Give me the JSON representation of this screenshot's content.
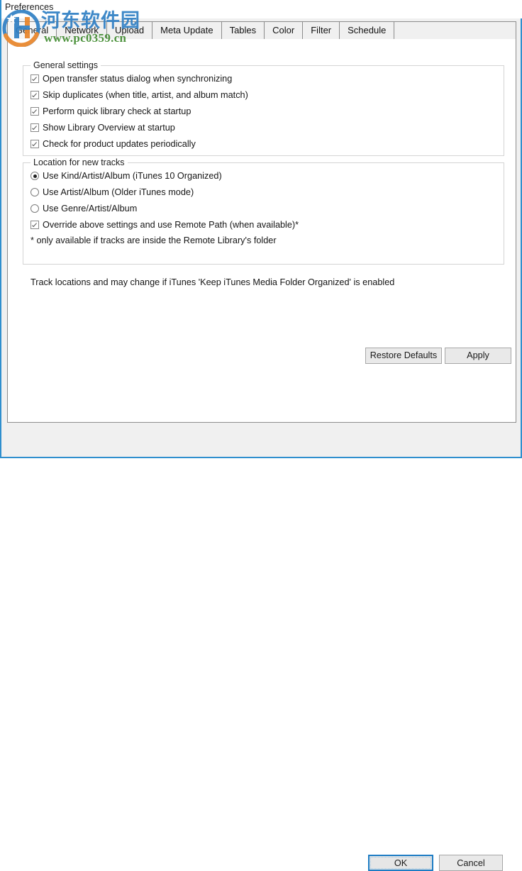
{
  "window": {
    "title": "Preferences",
    "accent_border_color": "#2f8fce",
    "dialog_bg": "#f0f0f0",
    "panel_bg": "#ffffff"
  },
  "tabs": [
    {
      "label": "General",
      "active": true
    },
    {
      "label": "Network",
      "active": false
    },
    {
      "label": "Upload",
      "active": false
    },
    {
      "label": "Meta Update",
      "active": false
    },
    {
      "label": "Tables",
      "active": false
    },
    {
      "label": "Color",
      "active": false
    },
    {
      "label": "Filter",
      "active": false
    },
    {
      "label": "Schedule",
      "active": false
    }
  ],
  "general_settings": {
    "legend": "General settings",
    "checkboxes": [
      {
        "label": "Open transfer status dialog when synchronizing",
        "checked": true
      },
      {
        "label": "Skip duplicates (when title, artist, and album match)",
        "checked": true
      },
      {
        "label": "Perform quick library check at startup",
        "checked": true
      },
      {
        "label": "Show Library Overview at startup",
        "checked": true
      },
      {
        "label": "Check for product updates periodically",
        "checked": true
      }
    ]
  },
  "location_for_new_tracks": {
    "legend": "Location for new tracks",
    "radios": [
      {
        "label": "Use Kind/Artist/Album (iTunes 10 Organized)",
        "selected": true
      },
      {
        "label": "Use Artist/Album (Older iTunes mode)",
        "selected": false
      },
      {
        "label": "Use Genre/Artist/Album",
        "selected": false
      }
    ],
    "override_checkbox": {
      "label": "Override above settings and use Remote Path (when available)*",
      "checked": true
    },
    "footnote": "* only available if tracks are inside the Remote Library's folder"
  },
  "note": "Track locations and may change if iTunes 'Keep iTunes Media Folder Organized' is enabled",
  "panel_buttons": {
    "restore_defaults": "Restore Defaults",
    "apply": "Apply"
  },
  "dialog_buttons": {
    "ok": "OK",
    "cancel": "Cancel",
    "ok_focused": true
  },
  "watermark": {
    "site_name": "河东软件园",
    "url": "www.pc0359.cn",
    "text_color": "#2f7fc4",
    "url_color": "#3f8a2e"
  }
}
